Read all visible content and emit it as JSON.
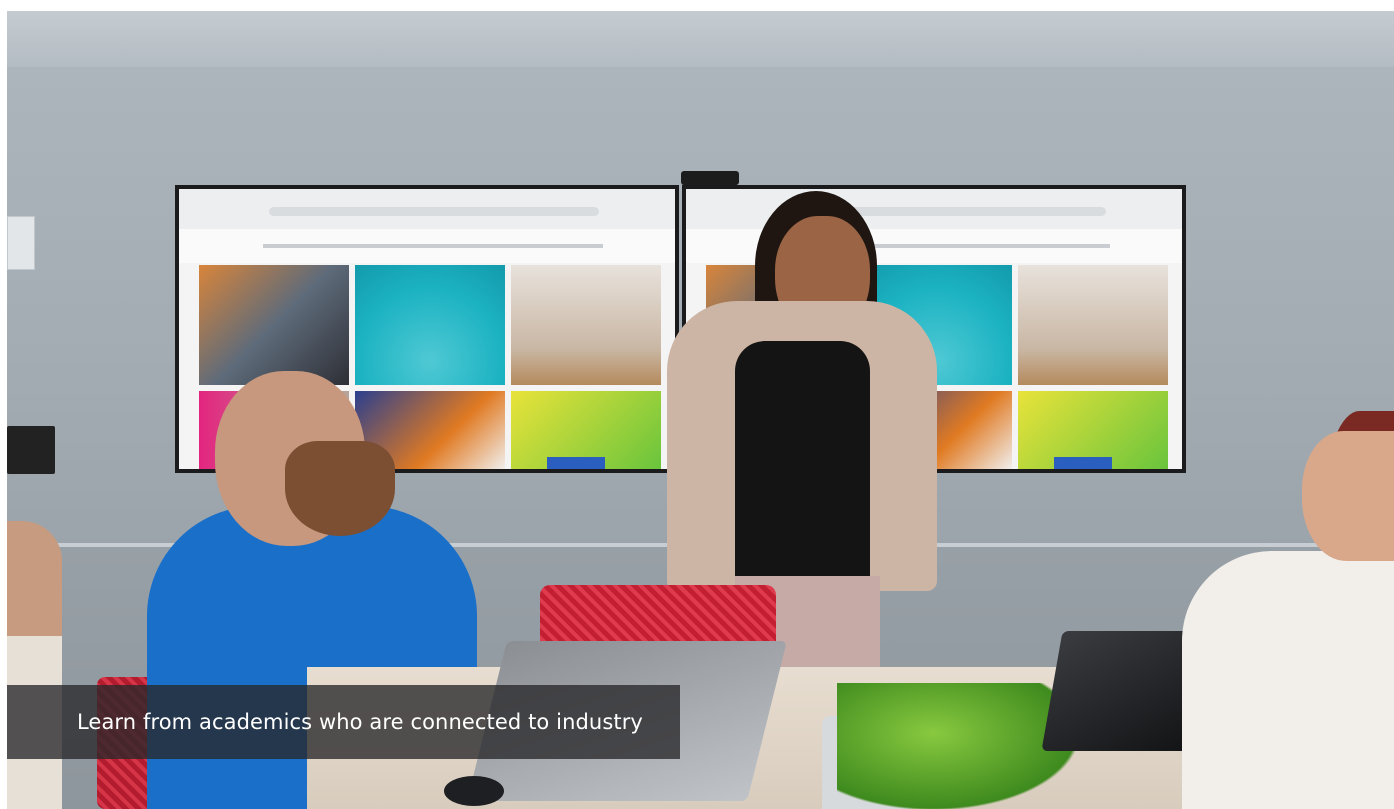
{
  "image": {
    "alt": "Woman presenting in front of two wall-mounted screens to colleagues seated around a meeting table"
  },
  "caption": {
    "text": "Learn from academics who are connected to industry"
  }
}
